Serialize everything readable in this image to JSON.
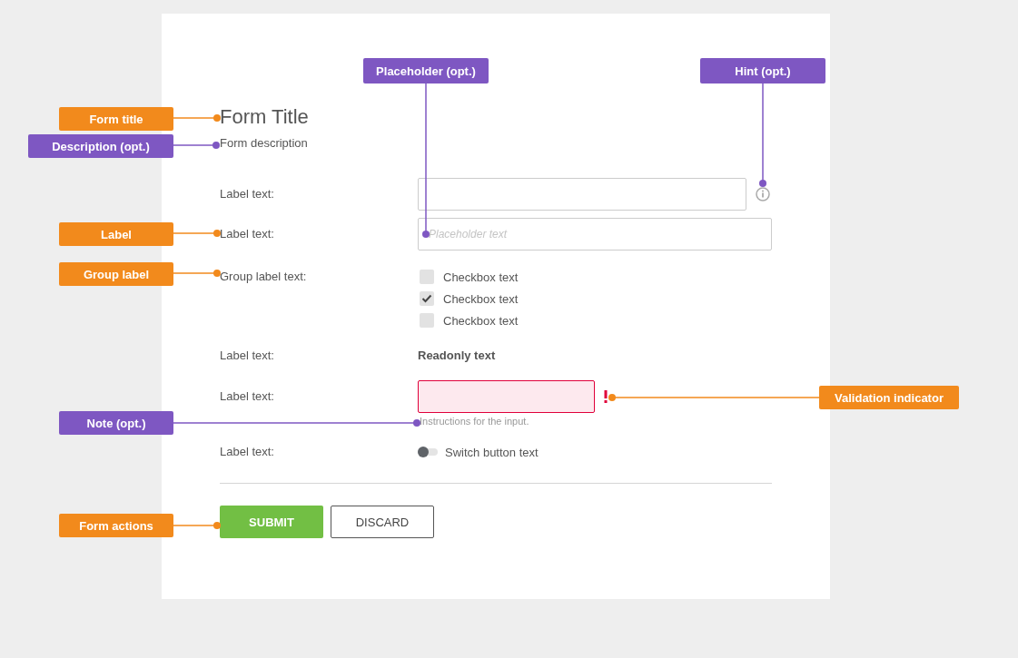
{
  "form": {
    "title": "Form Title",
    "description": "Form description",
    "fields": [
      {
        "kind": "input",
        "label": "Label text:",
        "hint": true,
        "invalid": false
      },
      {
        "kind": "input",
        "label": "Label text:",
        "placeholder": "Placeholder text",
        "hint": false,
        "invalid": false
      },
      {
        "kind": "checkboxes",
        "label": "Group label text:",
        "options": [
          {
            "label": "Checkbox text",
            "checked": false
          },
          {
            "label": "Checkbox text",
            "checked": true
          },
          {
            "label": "Checkbox text",
            "checked": false
          }
        ]
      },
      {
        "kind": "readonly",
        "label": "Label text:",
        "value": "Readonly text"
      },
      {
        "kind": "input",
        "label": "Label text:",
        "hint": false,
        "invalid": true,
        "note": "Instructions for the input."
      },
      {
        "kind": "switch",
        "label": "Label text:",
        "text": "Switch button text",
        "on": false
      }
    ],
    "actions": [
      {
        "label": "SUBMIT",
        "kind": "primary"
      },
      {
        "label": "DISCARD",
        "kind": "secondary"
      }
    ]
  },
  "annotations": [
    {
      "label": "Form title",
      "color": "#f28a1c"
    },
    {
      "label": "Description (opt.)",
      "color": "#7e57c2"
    },
    {
      "label": "Placeholder (opt.)",
      "color": "#7e57c2"
    },
    {
      "label": "Hint (opt.)",
      "color": "#7e57c2"
    },
    {
      "label": "Label",
      "color": "#f28a1c"
    },
    {
      "label": "Group label",
      "color": "#f28a1c"
    },
    {
      "label": "Validation indicator",
      "color": "#f28a1c"
    },
    {
      "label": "Note (opt.)",
      "color": "#7e57c2"
    },
    {
      "label": "Form actions",
      "color": "#f28a1c"
    }
  ]
}
